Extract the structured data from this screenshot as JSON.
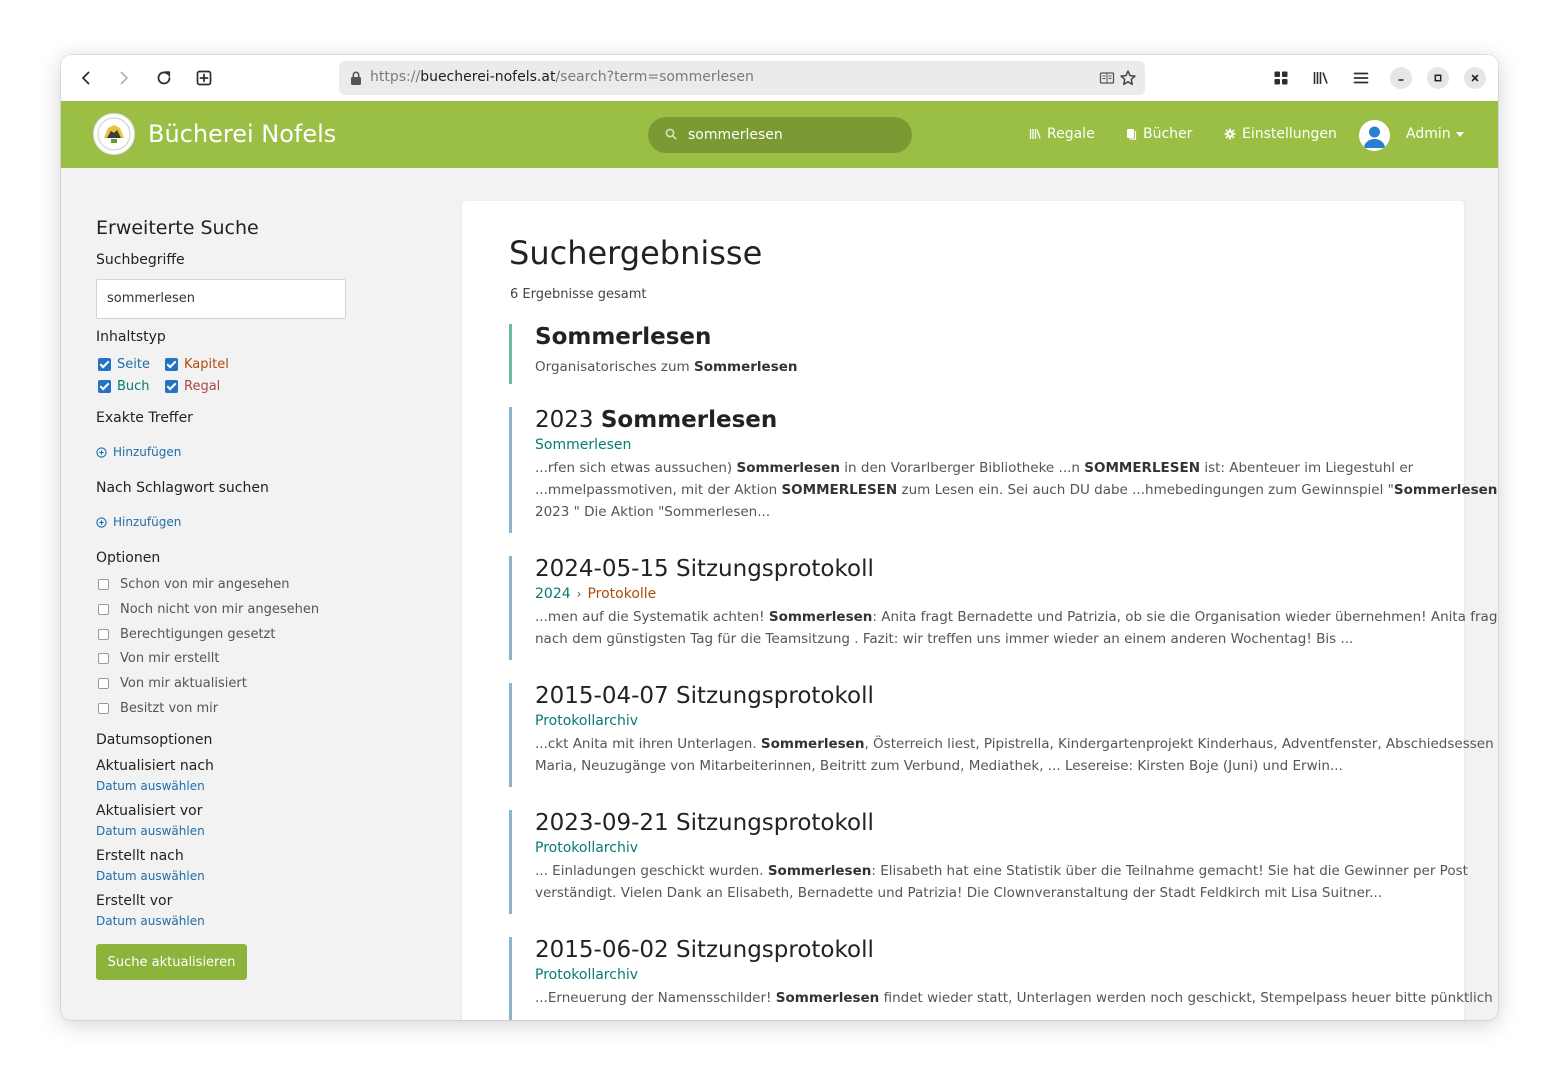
{
  "browser": {
    "url_prefix": "https://",
    "url_host": "buecherei-nofels.at",
    "url_path": "/search?term=sommerlesen"
  },
  "header": {
    "brand": "Bücherei Nofels",
    "search_value": "sommerlesen",
    "nav": {
      "shelves": "Regale",
      "books": "Bücher",
      "settings": "Einstellungen",
      "user": "Admin"
    }
  },
  "sidebar": {
    "title": "Erweiterte Suche",
    "search_terms_label": "Suchbegriffe",
    "search_terms_value": "sommerlesen",
    "content_type_label": "Inhaltstyp",
    "types": {
      "page": "Seite",
      "chapter": "Kapitel",
      "book": "Buch",
      "shelf": "Regal"
    },
    "exact_label": "Exakte Treffer",
    "exact_add": "Hinzufügen",
    "tag_label": "Nach Schlagwort suchen",
    "tag_add": "Hinzufügen",
    "options_label": "Optionen",
    "options": [
      "Schon von mir angesehen",
      "Noch nicht von mir angesehen",
      "Berechtigungen gesetzt",
      "Von mir erstellt",
      "Von mir aktualisiert",
      "Besitzt von mir"
    ],
    "date_options_label": "Datumsoptionen",
    "dates": [
      {
        "label": "Aktualisiert nach",
        "link": "Datum auswählen"
      },
      {
        "label": "Aktualisiert vor",
        "link": "Datum auswählen"
      },
      {
        "label": "Erstellt nach",
        "link": "Datum auswählen"
      },
      {
        "label": "Erstellt vor",
        "link": "Datum auswählen"
      }
    ],
    "update_button": "Suche aktualisieren"
  },
  "results": {
    "title": "Suchergebnisse",
    "count": "6 Ergebnisse gesamt",
    "items": [
      {
        "title_bold": "Sommerlesen",
        "subtitle_pre": "Organisatorisches zum ",
        "subtitle_bold": "Sommerlesen"
      },
      {
        "title_pre": "2023 ",
        "title_bold": "Sommerlesen",
        "crumb_book": "Sommerlesen",
        "line1_a": "...rfen sich etwas aussuchen) ",
        "line1_b": "Sommerlesen",
        "line1_c": " in den Vorarlberger Bibliotheke ...n ",
        "line1_d": "SOMMERLESEN",
        "line1_e": " ist: Abenteuer im Liegestuhl er",
        "line2_a": "...mmelpassmotiven, mit der Aktion ",
        "line2_b": "SOMMERLESEN",
        "line2_c": " zum Lesen ein. Sei auch DU dabe ...hmebedingungen zum Gewinnspiel \"",
        "line2_d": "Sommerlesen",
        "line3": "2023 \" Die Aktion \"Sommerlesen..."
      },
      {
        "title": "2024-05-15 Sitzungsprotokoll",
        "crumb_book": "2024",
        "crumb_chapter": "Protokolle",
        "line1_a": "...men auf die Systematik achten! ",
        "line1_b": "Sommerlesen",
        "line1_c": ": Anita fragt Bernadette und Patrizia, ob sie die Organisation wieder übernehmen! Anita fragt",
        "line2": "nach dem günstigsten Tag für die Teamsitzung . Fazit: wir treffen uns immer wieder an einem anderen Wochentag! Bis ..."
      },
      {
        "title": "2015-04-07 Sitzungsprotokoll",
        "crumb_book": "Protokollarchiv",
        "line1_a": "...ckt Anita mit ihren Unterlagen. ",
        "line1_b": "Sommerlesen",
        "line1_c": ", Österreich liest, Pipistrella, Kindergartenprojekt Kinderhaus, Adventfenster, Abschiedsessen",
        "line2": "Maria, Neuzugänge von Mitarbeiterinnen, Beitritt zum Verbund, Mediathek, ... Lesereise: Kirsten Boje (Juni) und Erwin..."
      },
      {
        "title": "2023-09-21 Sitzungsprotokoll",
        "crumb_book": "Protokollarchiv",
        "line1_a": "... Einladungen geschickt wurden. ",
        "line1_b": "Sommerlesen",
        "line1_c": ": Elisabeth hat eine Statistik über die Teilnahme gemacht! Sie hat die Gewinner per Post",
        "line2": "verständigt. Vielen Dank an Elisabeth, Bernadette und Patrizia! Die Clownveranstaltung der Stadt Feldkirch mit Lisa Suitner..."
      },
      {
        "title": "2015-06-02 Sitzungsprotokoll",
        "crumb_book": "Protokollarchiv",
        "line1_a": "...Erneuerung der Namensschilder! ",
        "line1_b": "Sommerlesen",
        "line1_c": " findet wieder statt, Unterlagen werden noch geschickt, Stempelpass heuer bitte pünktlich"
      }
    ]
  },
  "colors": {
    "header_green": "#9bbf45",
    "button_green": "#8cb33c",
    "link_blue": "#206ea7",
    "book_teal": "#077b70",
    "chapter_orange": "#af4d0d",
    "shelf_red": "#a94747"
  }
}
